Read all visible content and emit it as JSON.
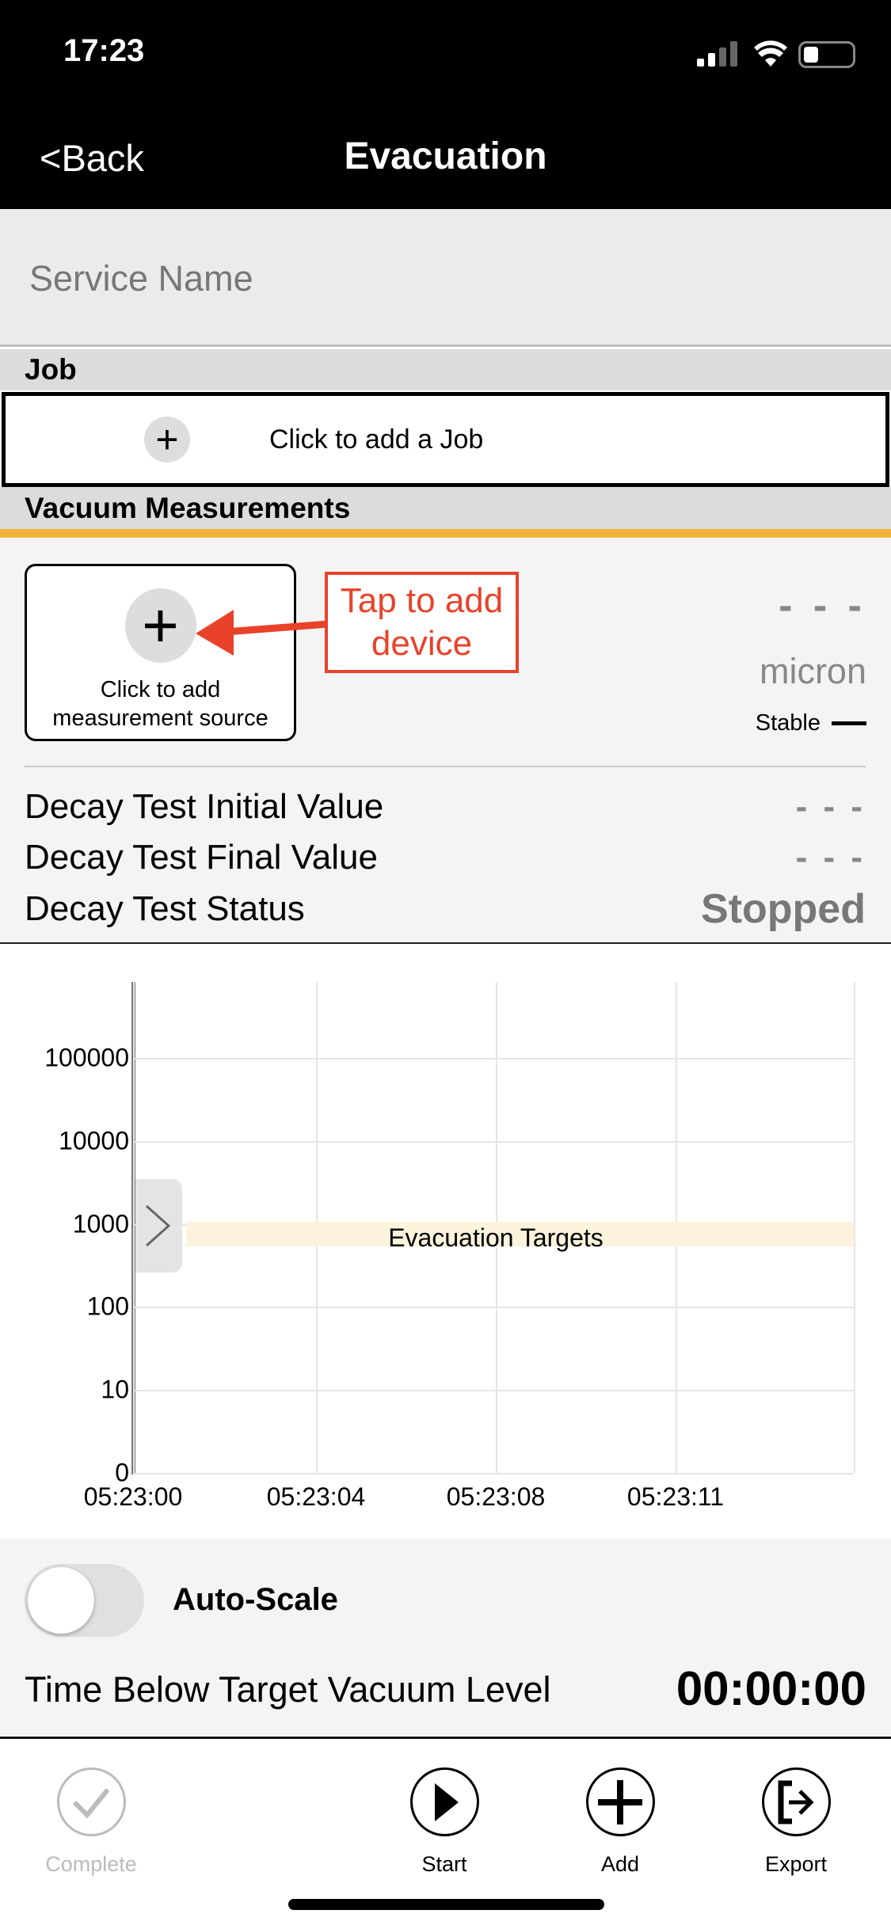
{
  "status_bar": {
    "time": "17:23"
  },
  "nav": {
    "back_label": "<Back",
    "title": "Evacuation"
  },
  "service_name": {
    "placeholder": "Service Name"
  },
  "job": {
    "header": "Job",
    "add_label": "Click to add a Job"
  },
  "vacuum": {
    "header": "Vacuum Measurements",
    "add_source_label_1": "Click to add",
    "add_source_label_2": "measurement source",
    "annotation_1": "Tap to add",
    "annotation_2": "device",
    "reading": "- - -",
    "unit": "micron",
    "stability": "Stable",
    "accent_color": "#f0b43c",
    "annotation_color": "#e8432a"
  },
  "decay": {
    "rows": [
      {
        "label": "Decay Test Initial Value",
        "value": "- - -"
      },
      {
        "label": "Decay Test Final Value",
        "value": "- - -"
      },
      {
        "label": "Decay Test Status",
        "value": "Stopped"
      }
    ]
  },
  "chart_data": {
    "type": "line",
    "y_scale": "log",
    "y_ticks": [
      "100000",
      "10000",
      "1000",
      "100",
      "10",
      "0"
    ],
    "x_ticks": [
      "05:23:00",
      "05:23:04",
      "05:23:08",
      "05:23:11"
    ],
    "series": [],
    "band": {
      "label": "Evacuation Targets",
      "range": [
        500,
        1000
      ],
      "color": "#fbf3dc"
    },
    "grid": true
  },
  "controls": {
    "auto_scale_label": "Auto-Scale",
    "auto_scale_on": false,
    "time_below_label": "Time Below Target Vacuum Level",
    "time_below_value": "00:00:00"
  },
  "tabbar": {
    "items": [
      {
        "label": "Complete",
        "icon": "checkmark-circle-icon",
        "enabled": false
      },
      {
        "label": "Start",
        "icon": "play-circle-icon",
        "enabled": true
      },
      {
        "label": "Add",
        "icon": "plus-circle-icon",
        "enabled": true
      },
      {
        "label": "Export",
        "icon": "export-circle-icon",
        "enabled": true
      }
    ]
  }
}
